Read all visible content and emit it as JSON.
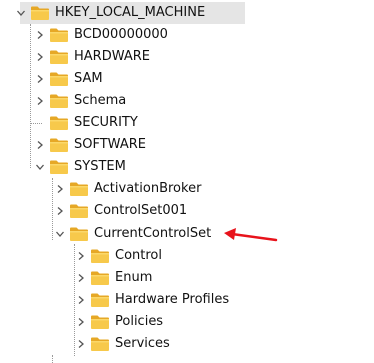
{
  "tree": {
    "root": {
      "label": "HKEY_LOCAL_MACHINE",
      "expanded": true,
      "selected": true
    },
    "level1": [
      {
        "label": "BCD00000000",
        "expanded": false
      },
      {
        "label": "HARDWARE",
        "expanded": false
      },
      {
        "label": "SAM",
        "expanded": false
      },
      {
        "label": "Schema",
        "expanded": false
      },
      {
        "label": "SECURITY",
        "expanded": false
      },
      {
        "label": "SOFTWARE",
        "expanded": false
      },
      {
        "label": "SYSTEM",
        "expanded": true
      }
    ],
    "system_children": [
      {
        "label": "ActivationBroker",
        "expanded": false
      },
      {
        "label": "ControlSet001",
        "expanded": false
      },
      {
        "label": "CurrentControlSet",
        "expanded": true
      }
    ],
    "currentcontrolset_children": [
      {
        "label": "Control",
        "expanded": false
      },
      {
        "label": "Enum",
        "expanded": false
      },
      {
        "label": "Hardware Profiles",
        "expanded": false
      },
      {
        "label": "Policies",
        "expanded": false
      },
      {
        "label": "Services",
        "expanded": false
      }
    ]
  },
  "annotation": {
    "arrow_color": "#e8131b"
  },
  "colors": {
    "folder": "#f7c94b",
    "folder_dark": "#e6a826",
    "selection": "#e5e5e5"
  },
  "icons": {
    "folder": "folder-icon",
    "collapsed": "chevron-right-icon",
    "expanded": "chevron-down-icon"
  }
}
